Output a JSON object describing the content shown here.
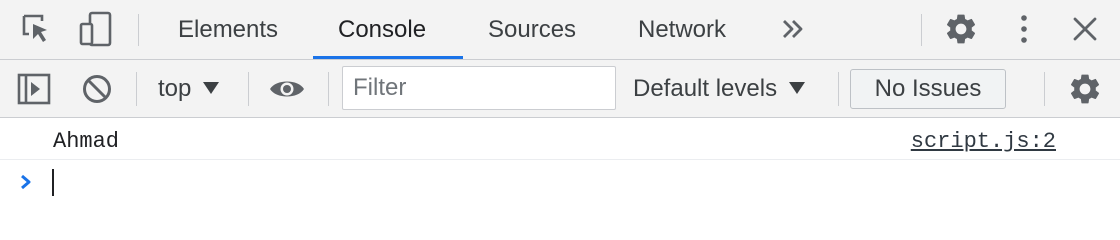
{
  "tabbar": {
    "tabs": [
      {
        "label": "Elements"
      },
      {
        "label": "Console"
      },
      {
        "label": "Sources"
      },
      {
        "label": "Network"
      }
    ],
    "more_tabs_icon": "double-chevron-right-icon",
    "icons": [
      "inspect-element-icon",
      "device-toggle-icon",
      "gear-icon",
      "kebab-menu-icon",
      "close-icon"
    ],
    "active_tab": "Console",
    "accent_color": "#1a73e8"
  },
  "toolbar": {
    "context": "top",
    "filter_placeholder": "Filter",
    "levels": "Default levels",
    "issues": "No Issues",
    "icons": [
      "sidebar-toggle-icon",
      "clear-console-icon",
      "eye-icon",
      "gear-icon"
    ]
  },
  "console": {
    "messages": [
      {
        "text": "Ahmad",
        "source": "script.js:2"
      }
    ],
    "prompt_icon": "prompt-chevron-icon",
    "prompt_color": "#1a73e8"
  }
}
